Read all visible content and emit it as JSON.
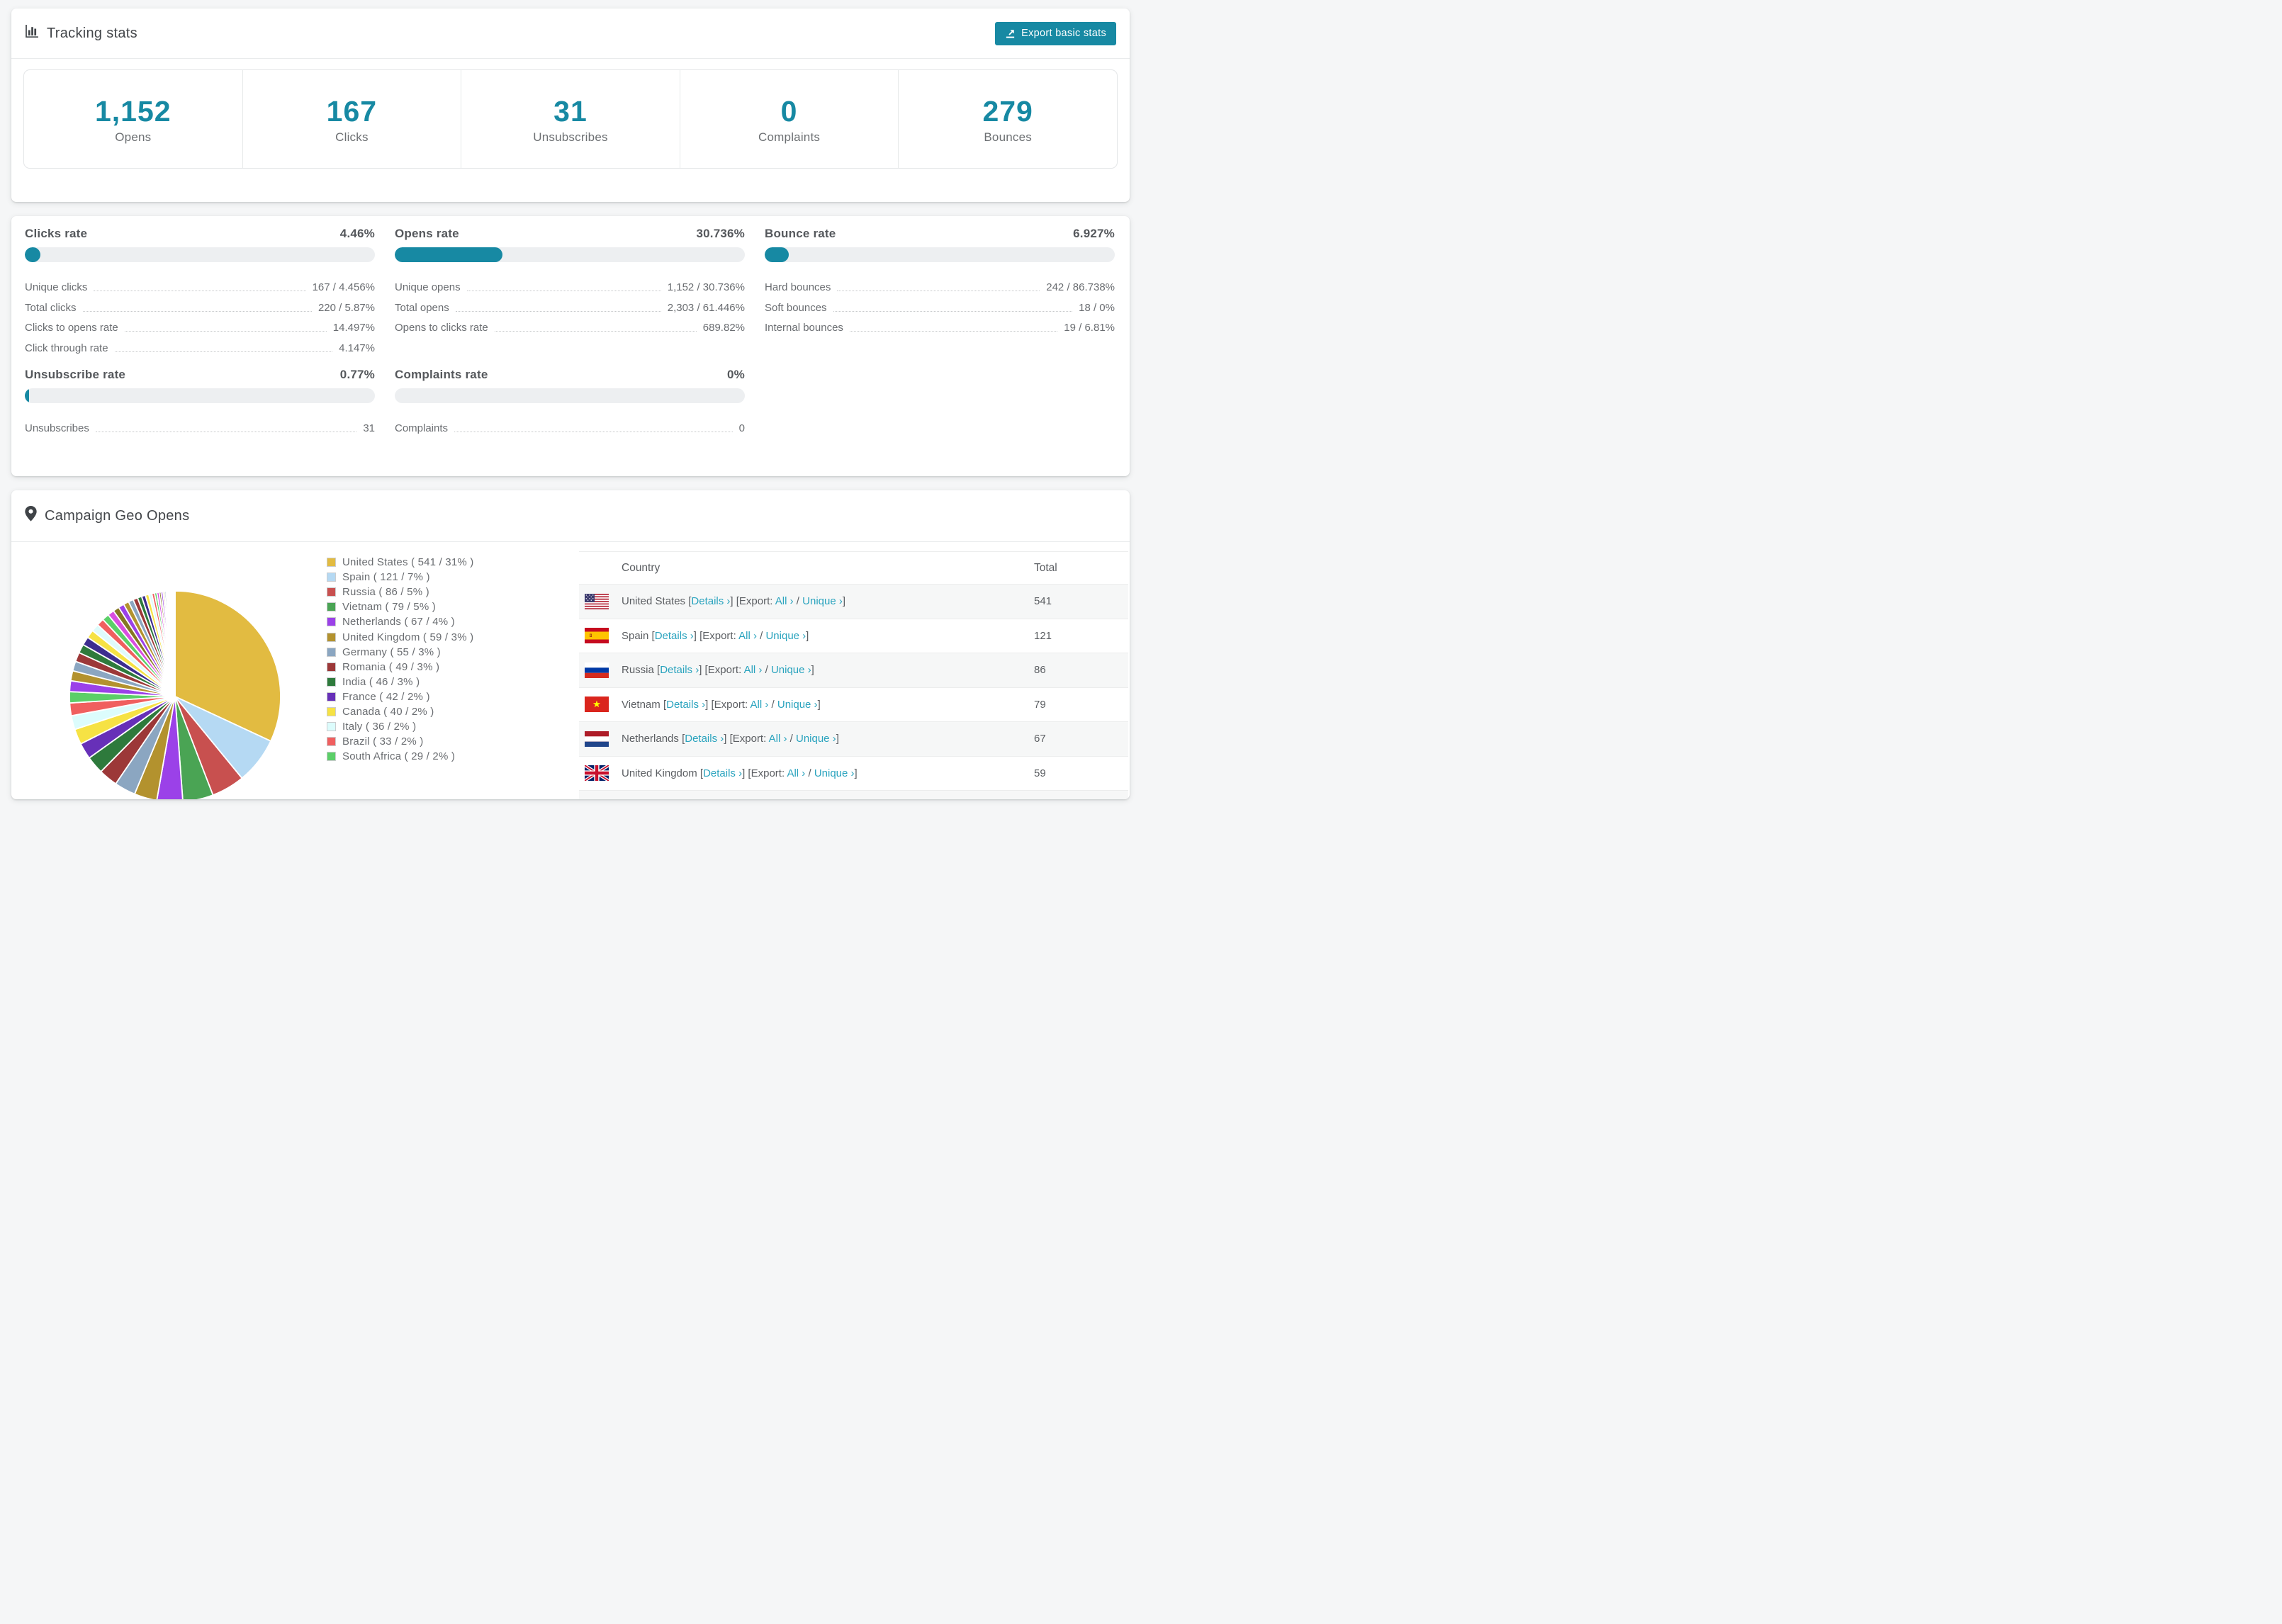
{
  "theme": {
    "accent": "#1789a3",
    "link": "#29a3be",
    "bar-track": "#edeff1",
    "stripe": "#f6f7f7",
    "page-bg": "#f5f6f7",
    "card-bg": "#ffffff",
    "title-color": "#43464a",
    "section-color": "#55585c",
    "muted-color": "#6a6d71",
    "table-color": "#5b5e62",
    "divider": "#e9ebec"
  },
  "tracking": {
    "title": "Tracking stats",
    "export_button": "Export basic stats",
    "stats": [
      {
        "value": "1,152",
        "label": "Opens"
      },
      {
        "value": "167",
        "label": "Clicks"
      },
      {
        "value": "31",
        "label": "Unsubscribes"
      },
      {
        "value": "0",
        "label": "Complaints"
      },
      {
        "value": "279",
        "label": "Bounces"
      }
    ]
  },
  "rates": [
    {
      "id": "clicks-rate",
      "title": "Clicks rate",
      "value": "4.46%",
      "percent": 4.46,
      "rows": [
        {
          "label": "Unique clicks",
          "value": "167 / 4.456%"
        },
        {
          "label": "Total clicks",
          "value": "220 / 5.87%"
        },
        {
          "label": "Clicks to opens rate",
          "value": "14.497%"
        },
        {
          "label": "Click through rate",
          "value": "4.147%"
        }
      ]
    },
    {
      "id": "opens-rate",
      "title": "Opens rate",
      "value": "30.736%",
      "percent": 30.736,
      "rows": [
        {
          "label": "Unique opens",
          "value": "1,152 / 30.736%"
        },
        {
          "label": "Total opens",
          "value": "2,303 / 61.446%"
        },
        {
          "label": "Opens to clicks rate",
          "value": "689.82%"
        }
      ]
    },
    {
      "id": "bounce-rate",
      "title": "Bounce rate",
      "value": "6.927%",
      "percent": 6.927,
      "rows": [
        {
          "label": "Hard bounces",
          "value": "242 / 86.738%"
        },
        {
          "label": "Soft bounces",
          "value": "18 / 0%"
        },
        {
          "label": "Internal bounces",
          "value": "19 / 6.81%"
        }
      ]
    },
    {
      "id": "unsubscribe-rate",
      "title": "Unsubscribe rate",
      "value": "0.77%",
      "percent": 0.77,
      "rows": [
        {
          "label": "Unsubscribes",
          "value": "31"
        }
      ]
    },
    {
      "id": "complaints-rate",
      "title": "Complaints rate",
      "value": "0%",
      "percent": 0,
      "rows": [
        {
          "label": "Complaints",
          "value": "0"
        }
      ]
    }
  ],
  "geo": {
    "title": "Campaign Geo Opens",
    "table": {
      "country_header": "Country",
      "total_header": "Total",
      "details_label": "Details ›",
      "export_label": "[Export:",
      "all_label": "All ›",
      "unique_label": "Unique ›",
      "visible_rows": 7
    },
    "countries": [
      {
        "name": "United States",
        "total": "541",
        "legend": "United States ( 541 / 31% )",
        "flag": "us"
      },
      {
        "name": "Spain",
        "total": "121",
        "legend": "Spain ( 121 / 7% )",
        "flag": "es"
      },
      {
        "name": "Russia",
        "total": "86",
        "legend": "Russia ( 86 / 5% )",
        "flag": "ru"
      },
      {
        "name": "Vietnam",
        "total": "79",
        "legend": "Vietnam ( 79 / 5% )",
        "flag": "vn"
      },
      {
        "name": "Netherlands",
        "total": "67",
        "legend": "Netherlands ( 67 / 4% )",
        "flag": "nl"
      },
      {
        "name": "United Kingdom",
        "total": "59",
        "legend": "United Kingdom ( 59 / 3% )",
        "flag": "gb"
      },
      {
        "name": "Germany",
        "total": "55",
        "legend": "Germany ( 55 / 3% )",
        "flag": "de"
      },
      {
        "name": "Romania",
        "total": "49",
        "legend": "Romania ( 49 / 3% )",
        "flag": "ro"
      },
      {
        "name": "India",
        "total": "46",
        "legend": "India ( 46 / 3% )",
        "flag": "in"
      },
      {
        "name": "France",
        "total": "42",
        "legend": "France ( 42 / 2% )",
        "flag": "fr"
      },
      {
        "name": "Canada",
        "total": "40",
        "legend": "Canada ( 40 / 2% )",
        "flag": "ca"
      },
      {
        "name": "Italy",
        "total": "36",
        "legend": "Italy ( 36 / 2% )",
        "flag": "it"
      },
      {
        "name": "Brazil",
        "total": "33",
        "legend": "Brazil ( 33 / 2% )",
        "flag": "br"
      },
      {
        "name": "South Africa",
        "total": "29",
        "legend": "South Africa ( 29 / 2% )",
        "flag": "za"
      }
    ]
  },
  "chart_data": {
    "type": "pie",
    "title": "Campaign Geo Opens",
    "start_angle_deg": -90,
    "direction": "clockwise",
    "legend_position": "right",
    "slices": [
      {
        "name": "United States",
        "value": 541,
        "percent": 31,
        "color": "#e2bb41"
      },
      {
        "name": "Spain",
        "value": 121,
        "percent": 7,
        "color": "#b5d9f3"
      },
      {
        "name": "Russia",
        "value": 86,
        "percent": 5,
        "color": "#c8504f"
      },
      {
        "name": "Vietnam",
        "value": 79,
        "percent": 5,
        "color": "#4aa454"
      },
      {
        "name": "Netherlands",
        "value": 67,
        "percent": 4,
        "color": "#9b41e8"
      },
      {
        "name": "United Kingdom",
        "value": 59,
        "percent": 3,
        "color": "#b3922e"
      },
      {
        "name": "Germany",
        "value": 55,
        "percent": 3,
        "color": "#8ba6c1"
      },
      {
        "name": "Romania",
        "value": 49,
        "percent": 3,
        "color": "#9c3838"
      },
      {
        "name": "India",
        "value": 46,
        "percent": 3,
        "color": "#2e7a3c"
      },
      {
        "name": "France",
        "value": 42,
        "percent": 2,
        "color": "#6730b8"
      },
      {
        "name": "Canada",
        "value": 40,
        "percent": 2,
        "color": "#f6e244"
      },
      {
        "name": "Italy",
        "value": 36,
        "percent": 2,
        "color": "#dcfcfc"
      },
      {
        "name": "Brazil",
        "value": 33,
        "percent": 2,
        "color": "#f05f5f"
      },
      {
        "name": "South Africa",
        "value": 29,
        "percent": 2,
        "color": "#5bcf68"
      }
    ],
    "other_slices": {
      "values": [
        28,
        26,
        25,
        24,
        23,
        22,
        21,
        20,
        19,
        18,
        17,
        16,
        15,
        14,
        13,
        12,
        11,
        10,
        9,
        8,
        7,
        6,
        6,
        5,
        5,
        4,
        4,
        3,
        3,
        3,
        2,
        2,
        2,
        2,
        1,
        1,
        1,
        1,
        1,
        1
      ],
      "colors_cycle": [
        "#9b41e8",
        "#b3922e",
        "#8ba6c1",
        "#9c3838",
        "#2e7a3c",
        "#3d2d8f",
        "#f6e244",
        "#dffbfb",
        "#f05f5f",
        "#5bcf68",
        "#d84fe0",
        "#857722"
      ]
    }
  }
}
